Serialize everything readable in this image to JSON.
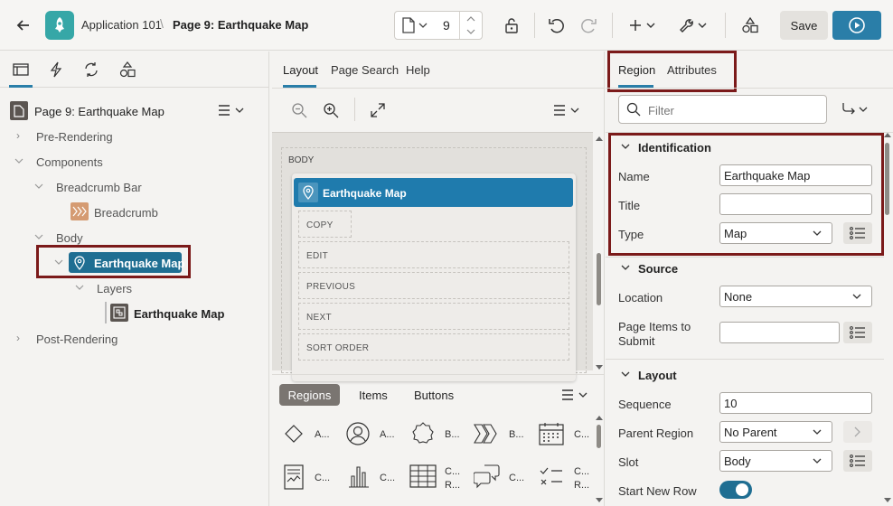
{
  "toolbar": {
    "app_name": "Application 101",
    "page_title": "Page 9: Earthquake Map",
    "page_number": "9",
    "save_label": "Save"
  },
  "tree": {
    "root_label": "Page 9: Earthquake Map",
    "pre_rendering": "Pre-Rendering",
    "components": "Components",
    "breadcrumb_bar": "Breadcrumb Bar",
    "breadcrumb": "Breadcrumb",
    "body": "Body",
    "earthquake_map": "Earthquake Map",
    "layers": "Layers",
    "layer_item": "Earthquake Map",
    "post_rendering": "Post-Rendering"
  },
  "middle": {
    "tabs": [
      "Layout",
      "Page Search",
      "Help"
    ],
    "body_label": "BODY",
    "region_title": "Earthquake Map",
    "slots": [
      "COPY",
      "EDIT",
      "PREVIOUS",
      "NEXT",
      "SORT ORDER"
    ],
    "palette_tabs": [
      "Regions",
      "Items",
      "Buttons"
    ],
    "palette_row1": [
      "A...",
      "A...",
      "B...",
      "B...",
      "C..."
    ],
    "palette_row2": [
      {
        "line1": "C...",
        "line2": ""
      },
      {
        "line1": "C...",
        "line2": ""
      },
      {
        "line1": "C...",
        "line2": "R..."
      },
      {
        "line1": "C...",
        "line2": ""
      },
      {
        "line1": "C...",
        "line2": "R..."
      }
    ]
  },
  "right": {
    "tabs": [
      "Region",
      "Attributes"
    ],
    "filter_placeholder": "Filter",
    "identification": {
      "heading": "Identification",
      "name_label": "Name",
      "name_value": "Earthquake Map",
      "title_label": "Title",
      "title_value": "",
      "type_label": "Type",
      "type_value": "Map"
    },
    "source": {
      "heading": "Source",
      "location_label": "Location",
      "location_value": "None",
      "page_items_label_1": "Page Items to",
      "page_items_label_2": "Submit",
      "page_items_value": ""
    },
    "layout": {
      "heading": "Layout",
      "sequence_label": "Sequence",
      "sequence_value": "10",
      "parent_label": "Parent Region",
      "parent_value": "No Parent",
      "slot_label": "Slot",
      "slot_value": "Body",
      "new_row_label": "Start New Row"
    }
  }
}
